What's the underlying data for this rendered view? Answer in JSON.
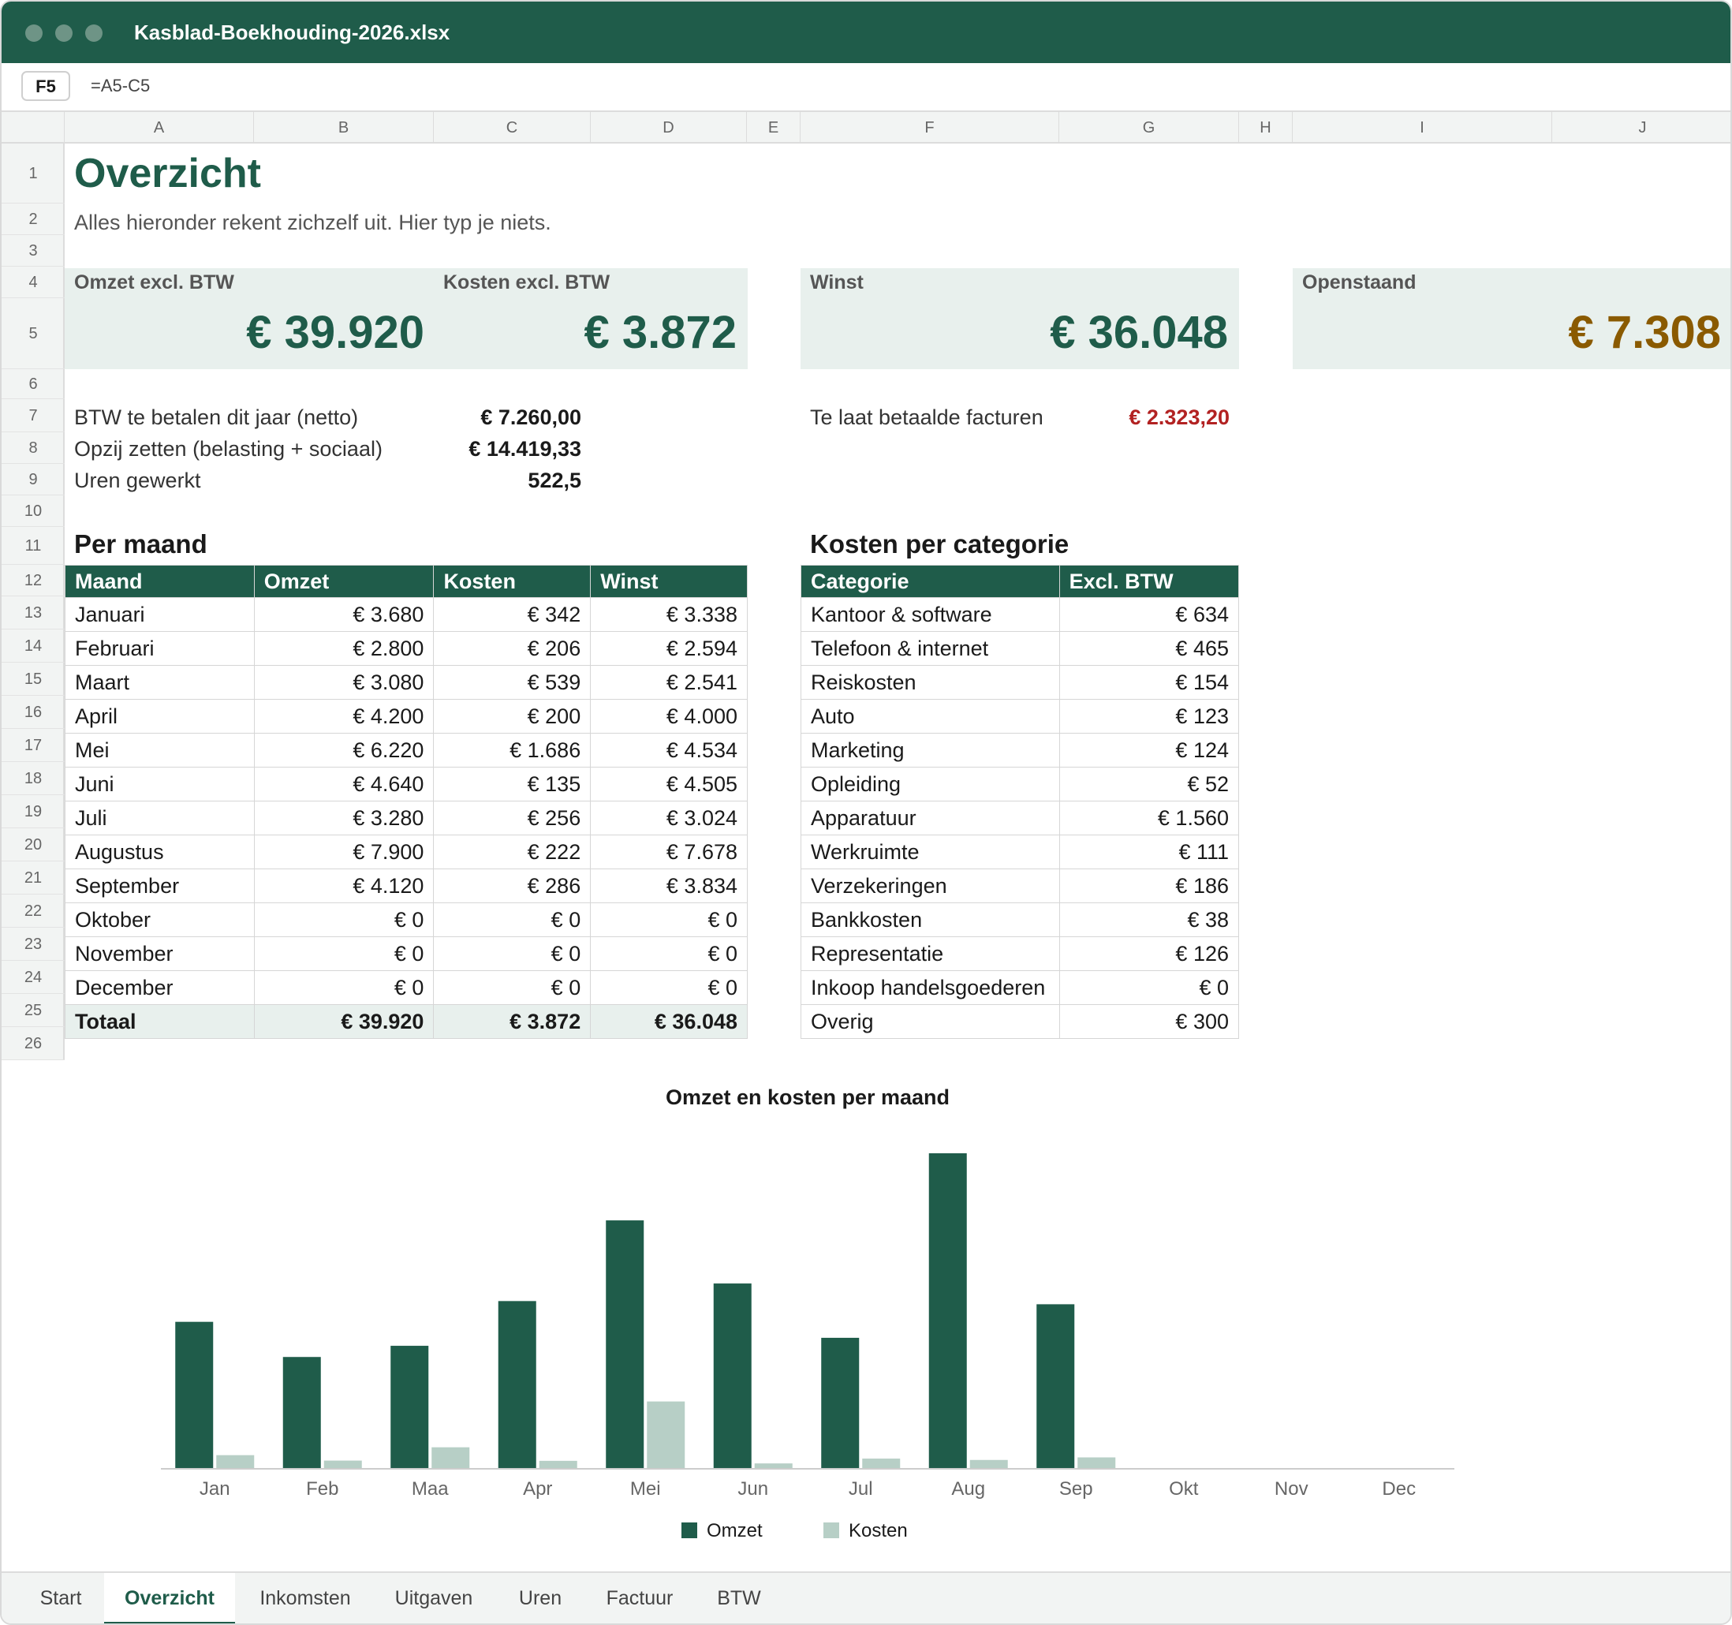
{
  "window": {
    "title": "Kasblad-Boekhouding-2026.xlsx"
  },
  "formula_bar": {
    "cell_ref": "F5",
    "formula": "=A5-C5"
  },
  "columns": [
    "A",
    "B",
    "C",
    "D",
    "E",
    "F",
    "G",
    "H",
    "I",
    "J"
  ],
  "rows": [
    "1",
    "2",
    "3",
    "4",
    "5",
    "6",
    "7",
    "8",
    "9",
    "10",
    "11",
    "12",
    "13",
    "14",
    "15",
    "16",
    "17",
    "18",
    "19",
    "20",
    "21",
    "22",
    "23",
    "24",
    "25",
    "26"
  ],
  "sheet": {
    "title": "Overzicht",
    "subtitle": "Alles hieronder rekent zichzelf uit. Hier typ je niets.",
    "kpis": {
      "omzet": {
        "label": "Omzet excl. BTW",
        "value": "€ 39.920"
      },
      "kosten": {
        "label": "Kosten excl. BTW",
        "value": "€ 3.872"
      },
      "winst": {
        "label": "Winst",
        "value": "€ 36.048"
      },
      "openstaand": {
        "label": "Openstaand",
        "value": "€ 7.308"
      }
    },
    "info": {
      "btw_label": "BTW te betalen dit jaar (netto)",
      "btw_value": "€ 7.260,00",
      "opzij_label": "Opzij zetten (belasting + sociaal)",
      "opzij_value": "€ 14.419,33",
      "uren_label": "Uren gewerkt",
      "uren_value": "522,5",
      "telaat_label": "Te laat betaalde facturen",
      "telaat_value": "€ 2.323,20"
    },
    "per_maand": {
      "heading": "Per maand",
      "headers": [
        "Maand",
        "Omzet",
        "Kosten",
        "Winst"
      ],
      "rows": [
        [
          "Januari",
          "€ 3.680",
          "€ 342",
          "€ 3.338"
        ],
        [
          "Februari",
          "€ 2.800",
          "€ 206",
          "€ 2.594"
        ],
        [
          "Maart",
          "€ 3.080",
          "€ 539",
          "€ 2.541"
        ],
        [
          "April",
          "€ 4.200",
          "€ 200",
          "€ 4.000"
        ],
        [
          "Mei",
          "€ 6.220",
          "€ 1.686",
          "€ 4.534"
        ],
        [
          "Juni",
          "€ 4.640",
          "€ 135",
          "€ 4.505"
        ],
        [
          "Juli",
          "€ 3.280",
          "€ 256",
          "€ 3.024"
        ],
        [
          "Augustus",
          "€ 7.900",
          "€ 222",
          "€ 7.678"
        ],
        [
          "September",
          "€ 4.120",
          "€ 286",
          "€ 3.834"
        ],
        [
          "Oktober",
          "€ 0",
          "€ 0",
          "€ 0"
        ],
        [
          "November",
          "€ 0",
          "€ 0",
          "€ 0"
        ],
        [
          "December",
          "€ 0",
          "€ 0",
          "€ 0"
        ]
      ],
      "total": [
        "Totaal",
        "€ 39.920",
        "€ 3.872",
        "€ 36.048"
      ]
    },
    "kosten_categorie": {
      "heading": "Kosten per categorie",
      "headers": [
        "Categorie",
        "Excl. BTW"
      ],
      "rows": [
        [
          "Kantoor & software",
          "€ 634"
        ],
        [
          "Telefoon & internet",
          "€ 465"
        ],
        [
          "Reiskosten",
          "€ 154"
        ],
        [
          "Auto",
          "€ 123"
        ],
        [
          "Marketing",
          "€ 124"
        ],
        [
          "Opleiding",
          "€ 52"
        ],
        [
          "Apparatuur",
          "€ 1.560"
        ],
        [
          "Werkruimte",
          "€ 111"
        ],
        [
          "Verzekeringen",
          "€ 186"
        ],
        [
          "Bankkosten",
          "€ 38"
        ],
        [
          "Representatie",
          "€ 126"
        ],
        [
          "Inkoop handelsgoederen",
          "€ 0"
        ],
        [
          "Overig",
          "€ 300"
        ]
      ]
    }
  },
  "chart_data": {
    "type": "bar",
    "title": "Omzet en kosten per maand",
    "categories": [
      "Jan",
      "Feb",
      "Maa",
      "Apr",
      "Mei",
      "Jun",
      "Jul",
      "Aug",
      "Sep",
      "Okt",
      "Nov",
      "Dec"
    ],
    "series": [
      {
        "name": "Omzet",
        "color": "#1f5c4a",
        "values": [
          3680,
          2800,
          3080,
          4200,
          6220,
          4640,
          3280,
          7900,
          4120,
          0,
          0,
          0
        ]
      },
      {
        "name": "Kosten",
        "color": "#b7cfc6",
        "values": [
          342,
          206,
          539,
          200,
          1686,
          135,
          256,
          222,
          286,
          0,
          0,
          0
        ]
      }
    ],
    "ylim": [
      0,
      7900
    ],
    "grid": false,
    "legend": "bottom"
  },
  "tabs": [
    "Start",
    "Overzicht",
    "Inkomsten",
    "Uitgaven",
    "Uren",
    "Factuur",
    "BTW"
  ],
  "active_tab": "Overzicht",
  "colors": {
    "accent": "#1f5c4a",
    "kpi_bg": "#e8f0ed",
    "openstaand": "#8a5a00",
    "late": "#b22222"
  }
}
